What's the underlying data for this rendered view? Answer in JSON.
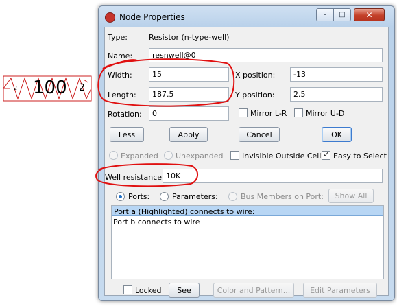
{
  "schematic": {
    "value": "100",
    "left_pin": "2",
    "right_pin": "2",
    "colors": {
      "outline": "#cc2222",
      "text": "#000000"
    }
  },
  "window": {
    "title": "Node Properties",
    "title_icon": "app-icon",
    "caption_buttons": {
      "minimize": "–",
      "maximize": "□",
      "close": "✕"
    }
  },
  "props": {
    "type_label": "Type:",
    "type_value": "Resistor (n-type-well)",
    "name_label": "Name:",
    "name_value": "resnwell@0",
    "width_label": "Width:",
    "width_value": "15",
    "xpos_label": "X position:",
    "xpos_value": "-13",
    "length_label": "Length:",
    "length_value": "187.5",
    "ypos_label": "Y position:",
    "ypos_value": "2.5",
    "rotation_label": "Rotation:",
    "rotation_value": "0",
    "mirror_lr": "Mirror L-R",
    "mirror_ud": "Mirror U-D"
  },
  "buttons": {
    "less": "Less",
    "apply": "Apply",
    "cancel": "Cancel",
    "ok": "OK"
  },
  "options": {
    "expanded": "Expanded",
    "unexpanded": "Unexpanded",
    "invisible_outside": "Invisible Outside Cell",
    "easy_to_select": "Easy to Select",
    "easy_to_select_checked": true
  },
  "well": {
    "label": "Well resistance:",
    "value": "10K"
  },
  "ports": {
    "ports_label": "Ports:",
    "parameters_label": "Parameters:",
    "bus_members_label": "Bus Members on Port:",
    "show_all": "Show All",
    "rows": [
      "Port a (Highlighted) connects to wire:",
      "Port b connects to wire"
    ]
  },
  "bottom": {
    "locked": "Locked",
    "see": "See",
    "color_pattern": "Color and Pattern...",
    "edit_parameters": "Edit Parameters"
  },
  "annotation_color": "#e01010"
}
